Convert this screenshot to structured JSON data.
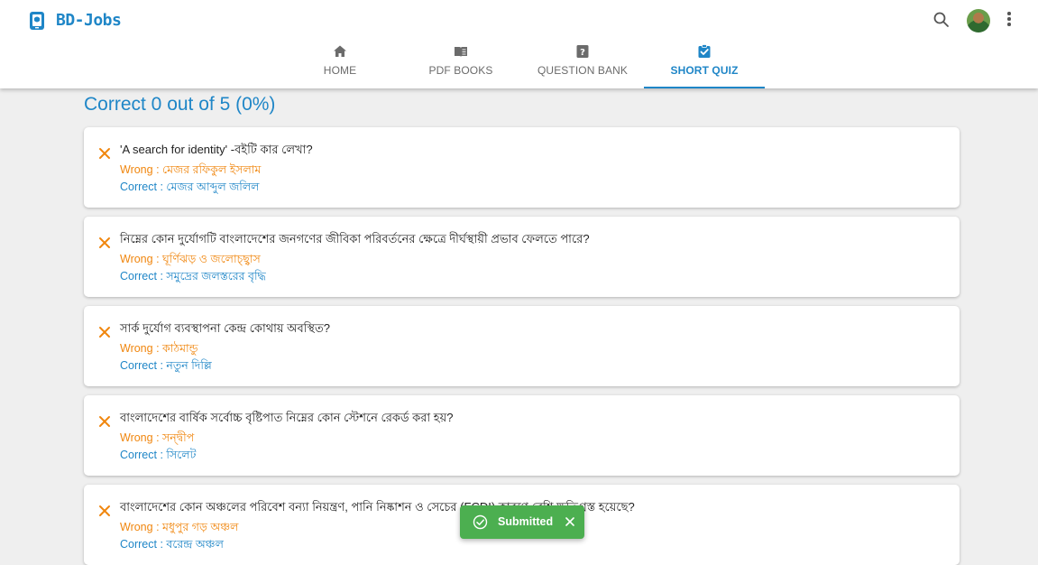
{
  "app": {
    "title": "BD-Jobs"
  },
  "nav": {
    "tabs": [
      {
        "label": "HOME",
        "icon": "home-icon"
      },
      {
        "label": "PDF BOOKS",
        "icon": "book-icon"
      },
      {
        "label": "QUESTION BANK",
        "icon": "help-box-icon"
      },
      {
        "label": "SHORT QUIZ",
        "icon": "clipboard-check-icon",
        "active": true
      }
    ]
  },
  "header_actions": {
    "search_icon": "search-icon",
    "avatar": "avatar",
    "more_icon": "more-vert-icon"
  },
  "result": {
    "summary": "Correct 0 out of 5 (0%)"
  },
  "answers": [
    {
      "question": "'A search for identity' -বইটি কার লেখা?",
      "wrong_label": "Wrong :",
      "wrong": "মেজর রফিকুল ইসলাম",
      "correct_label": "Correct :",
      "correct": "মেজর আব্দুল জলিল"
    },
    {
      "question": "নিম্নের কোন দুর্যোগটি বাংলাদেশের জনগণের জীবিকা পরিবর্তনের ক্ষেত্রে দীর্ঘস্থায়ী প্রভাব ফেলতে পারে?",
      "wrong_label": "Wrong :",
      "wrong": "ঘূর্ণিঝড় ও জলোচ্ছ্বাস",
      "correct_label": "Correct :",
      "correct": "সমুদ্রের জলস্তরের বৃদ্ধি"
    },
    {
      "question": "সার্ক দুর্যোগ ব্যবস্থাপনা কেন্দ্র কোথায় অবস্থিত?",
      "wrong_label": "Wrong :",
      "wrong": "কাঠমান্ডু",
      "correct_label": "Correct :",
      "correct": "নতুন দিল্লি"
    },
    {
      "question": "বাংলাদেশের বার্ষিক সর্বোচ্চ বৃষ্টিপাত নিম্নের কোন স্টেশনে রেকর্ড করা হয়?",
      "wrong_label": "Wrong :",
      "wrong": "সন্দ্বীপ",
      "correct_label": "Correct :",
      "correct": "সিলেট"
    },
    {
      "question": "বাংলাদেশের কোন অঞ্চলের পরিবেশ বন্যা নিয়ন্ত্রণ, পানি নিষ্কাশন ও সেচের (FCDI) কারণে বেশি ক্ষতিগ্রস্ত হয়েছে?",
      "wrong_label": "Wrong :",
      "wrong": "মধুপুর গড় অঞ্চল",
      "correct_label": "Correct :",
      "correct": "বরেন্দ্র অঞ্চল"
    }
  ],
  "toast": {
    "message": "Submitted"
  },
  "colors": {
    "accent": "#1f86c7",
    "wrong": "#f0860e",
    "toast_bg": "#4caf50"
  }
}
